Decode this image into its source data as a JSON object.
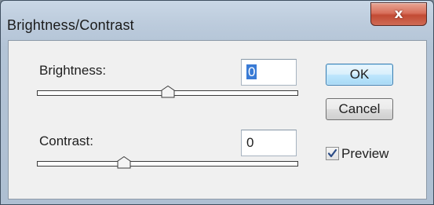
{
  "window": {
    "title": "Brightness/Contrast",
    "close_glyph": "x"
  },
  "brightness": {
    "label": "Brightness:",
    "value": "0",
    "slider_value": 0,
    "slider_range": [
      -150,
      150
    ]
  },
  "contrast": {
    "label": "Contrast:",
    "value": "0",
    "slider_value": 0,
    "slider_range": [
      -50,
      100
    ]
  },
  "buttons": {
    "ok_label": "OK",
    "cancel_label": "Cancel"
  },
  "preview": {
    "label": "Preview",
    "checked": true
  },
  "colors": {
    "title_bar": "#bccbdc",
    "close_button": "#c24b34",
    "client_bg": "#f0f0f0",
    "selection": "#3a7bd5",
    "default_button_border": "#3c7fb1"
  }
}
